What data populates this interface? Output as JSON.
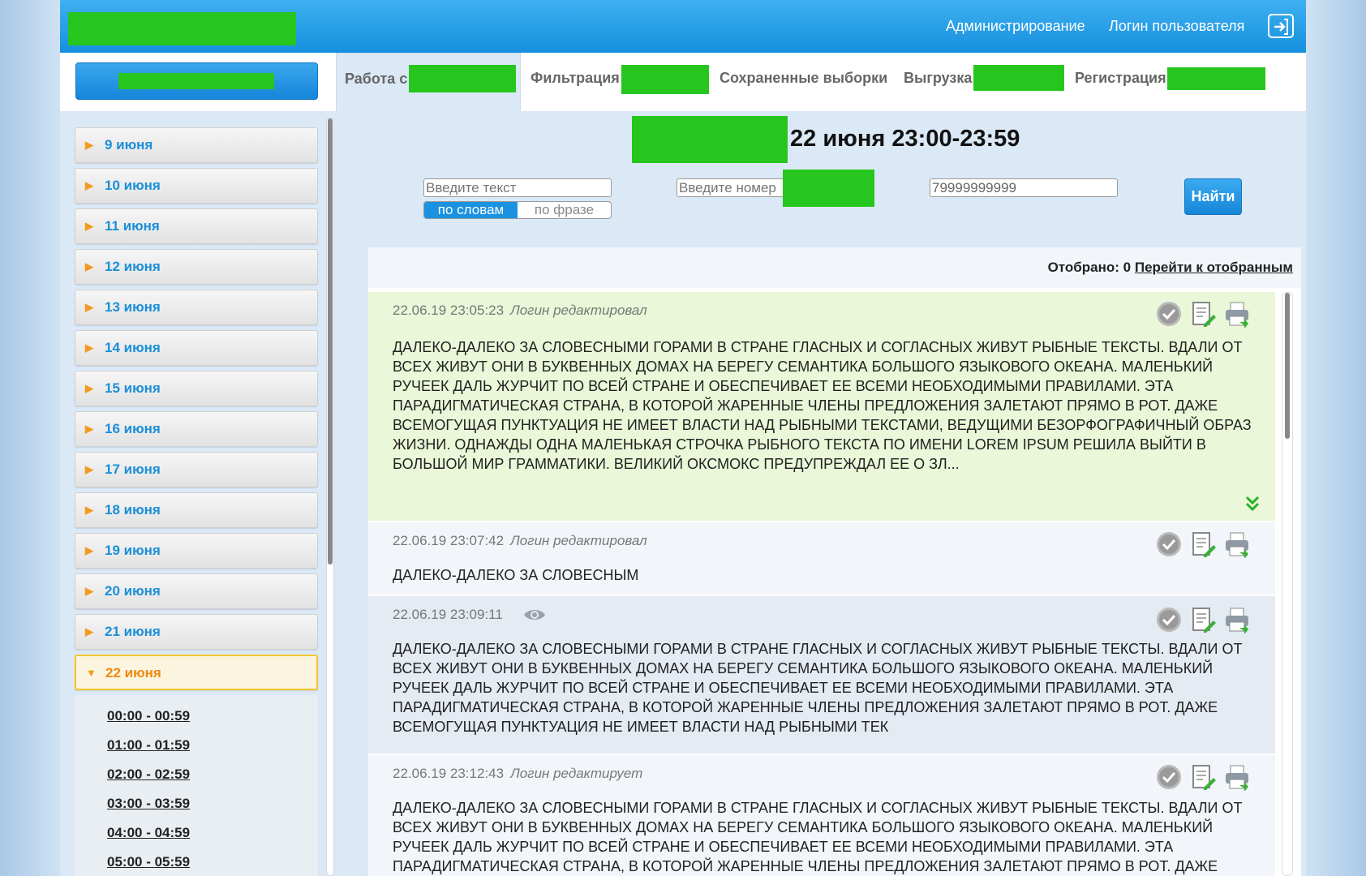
{
  "header": {
    "admin_link": "Администрирование",
    "user_login": "Логин пользователя"
  },
  "tabs": [
    {
      "label": "Работа с"
    },
    {
      "label": "Фильтрация"
    },
    {
      "label": "Сохраненные выборки"
    },
    {
      "label": "Выгрузка"
    },
    {
      "label": "Регистрация"
    }
  ],
  "sidebar": {
    "days": [
      "9 июня",
      "10 июня",
      "11 июня",
      "12 июня",
      "13 июня",
      "14 июня",
      "15 июня",
      "16 июня",
      "17 июня",
      "18 июня",
      "19 июня",
      "20 июня",
      "21 июня"
    ],
    "active_day": "22 июня",
    "hours": [
      "00:00 - 00:59",
      "01:00 - 01:59",
      "02:00 - 02:59",
      "03:00 - 03:59",
      "04:00 - 04:59",
      "05:00 - 05:59"
    ]
  },
  "page_title": "22 июня 23:00-23:59",
  "search": {
    "text_placeholder": "Введите текст",
    "number_placeholder": "Введите номер",
    "phone_value": "79999999999",
    "mode_words": "по словам",
    "mode_phrase": "по фразе",
    "find_label": "Найти"
  },
  "selection": {
    "label": "Отобрано:",
    "count": "0",
    "goto_link": "Перейти к отобранным"
  },
  "messages": [
    {
      "time": "22.06.19 23:05:23",
      "status": "Логин редактировал",
      "text": "ДАЛЕКО-ДАЛЕКО ЗА СЛОВЕСНЫМИ ГОРАМИ В СТРАНЕ ГЛАСНЫХ И СОГЛАСНЫХ ЖИВУТ РЫБНЫЕ ТЕКСТЫ. ВДАЛИ ОТ ВСЕХ ЖИВУТ ОНИ В БУКВЕННЫХ ДОМАХ НА БЕРЕГУ СЕМАНТИКА БОЛЬШОГО ЯЗЫКОВОГО ОКЕАНА. МАЛЕНЬКИЙ РУЧЕЕК ДАЛЬ ЖУРЧИТ ПО ВСЕЙ СТРАНЕ И ОБЕСПЕЧИВАЕТ ЕЕ ВСЕМИ НЕОБХОДИМЫМИ ПРАВИЛАМИ. ЭТА ПАРАДИГМАТИЧЕСКАЯ СТРАНА, В КОТОРОЙ ЖАРЕННЫЕ ЧЛЕНЫ ПРЕДЛОЖЕНИЯ ЗАЛЕТАЮТ ПРЯМО В РОТ. ДАЖЕ ВСЕМОГУЩАЯ ПУНКТУАЦИЯ НЕ ИМЕЕТ ВЛАСТИ НАД РЫБНЫМИ ТЕКСТАМИ, ВЕДУЩИМИ БЕЗОРФОГРАФИЧНЫЙ ОБРАЗ ЖИЗНИ. ОДНАЖДЫ ОДНА МАЛЕНЬКАЯ СТРОЧКА РЫБНОГО ТЕКСТА ПО ИМЕНИ LOREM IPSUM РЕШИЛА ВЫЙТИ В БОЛЬШОЙ МИР ГРАММАТИКИ. ВЕЛИКИЙ ОКСМОКС ПРЕДУПРЕЖДАЛ ЕЕ О ЗЛ..."
    },
    {
      "time": "22.06.19 23:07:42",
      "status": "Логин редактировал",
      "text": "ДАЛЕКО-ДАЛЕКО ЗА СЛОВЕСНЫМ"
    },
    {
      "time": "22.06.19 23:09:11",
      "status": "",
      "text": "ДАЛЕКО-ДАЛЕКО ЗА СЛОВЕСНЫМИ ГОРАМИ В СТРАНЕ ГЛАСНЫХ И СОГЛАСНЫХ ЖИВУТ РЫБНЫЕ ТЕКСТЫ. ВДАЛИ ОТ ВСЕХ ЖИВУТ ОНИ В БУКВЕННЫХ ДОМАХ НА БЕРЕГУ СЕМАНТИКА БОЛЬШОГО ЯЗЫКОВОГО ОКЕАНА. МАЛЕНЬКИЙ РУЧЕЕК ДАЛЬ ЖУРЧИТ ПО ВСЕЙ СТРАНЕ И ОБЕСПЕЧИВАЕТ ЕЕ ВСЕМИ НЕОБХОДИМЫМИ ПРАВИЛАМИ. ЭТА ПАРАДИГМАТИЧЕСКАЯ СТРАНА, В КОТОРОЙ ЖАРЕННЫЕ ЧЛЕНЫ ПРЕДЛОЖЕНИЯ ЗАЛЕТАЮТ ПРЯМО В РОТ. ДАЖЕ ВСЕМОГУЩАЯ ПУНКТУАЦИЯ НЕ ИМЕЕТ ВЛАСТИ НАД РЫБНЫМИ ТЕК"
    },
    {
      "time": "22.06.19 23:12:43",
      "status": "Логин редактирует",
      "text": "ДАЛЕКО-ДАЛЕКО ЗА СЛОВЕСНЫМИ ГОРАМИ В СТРАНЕ ГЛАСНЫХ И СОГЛАСНЫХ ЖИВУТ РЫБНЫЕ ТЕКСТЫ. ВДАЛИ ОТ ВСЕХ ЖИВУТ ОНИ В БУКВЕННЫХ ДОМАХ НА БЕРЕГУ СЕМАНТИКА БОЛЬШОГО ЯЗЫКОВОГО ОКЕАНА. МАЛЕНЬКИЙ РУЧЕЕК ДАЛЬ ЖУРЧИТ ПО ВСЕЙ СТРАНЕ И ОБЕСПЕЧИВАЕТ ЕЕ ВСЕМИ НЕОБХОДИМЫМИ ПРАВИЛАМИ. ЭТА ПАРАДИГМАТИЧЕСКАЯ СТРАНА, В КОТОРОЙ ЖАРЕННЫЕ ЧЛЕНЫ ПРЕДЛОЖЕНИЯ ЗАЛЕТАЮТ ПРЯМО В РОТ. ДАЖЕ"
    }
  ],
  "icons": {
    "message_actions": [
      "check-icon",
      "edit-note-icon",
      "print-icon"
    ],
    "expand": "double-chevron-down-icon",
    "viewed": "eye-icon"
  },
  "colors": {
    "accent_blue": "#1a8fd8",
    "topbar": "#2aa3ea",
    "highlight_message": "#eaf7d8",
    "active_day": "#f08a15",
    "redaction": "#26c61e"
  }
}
